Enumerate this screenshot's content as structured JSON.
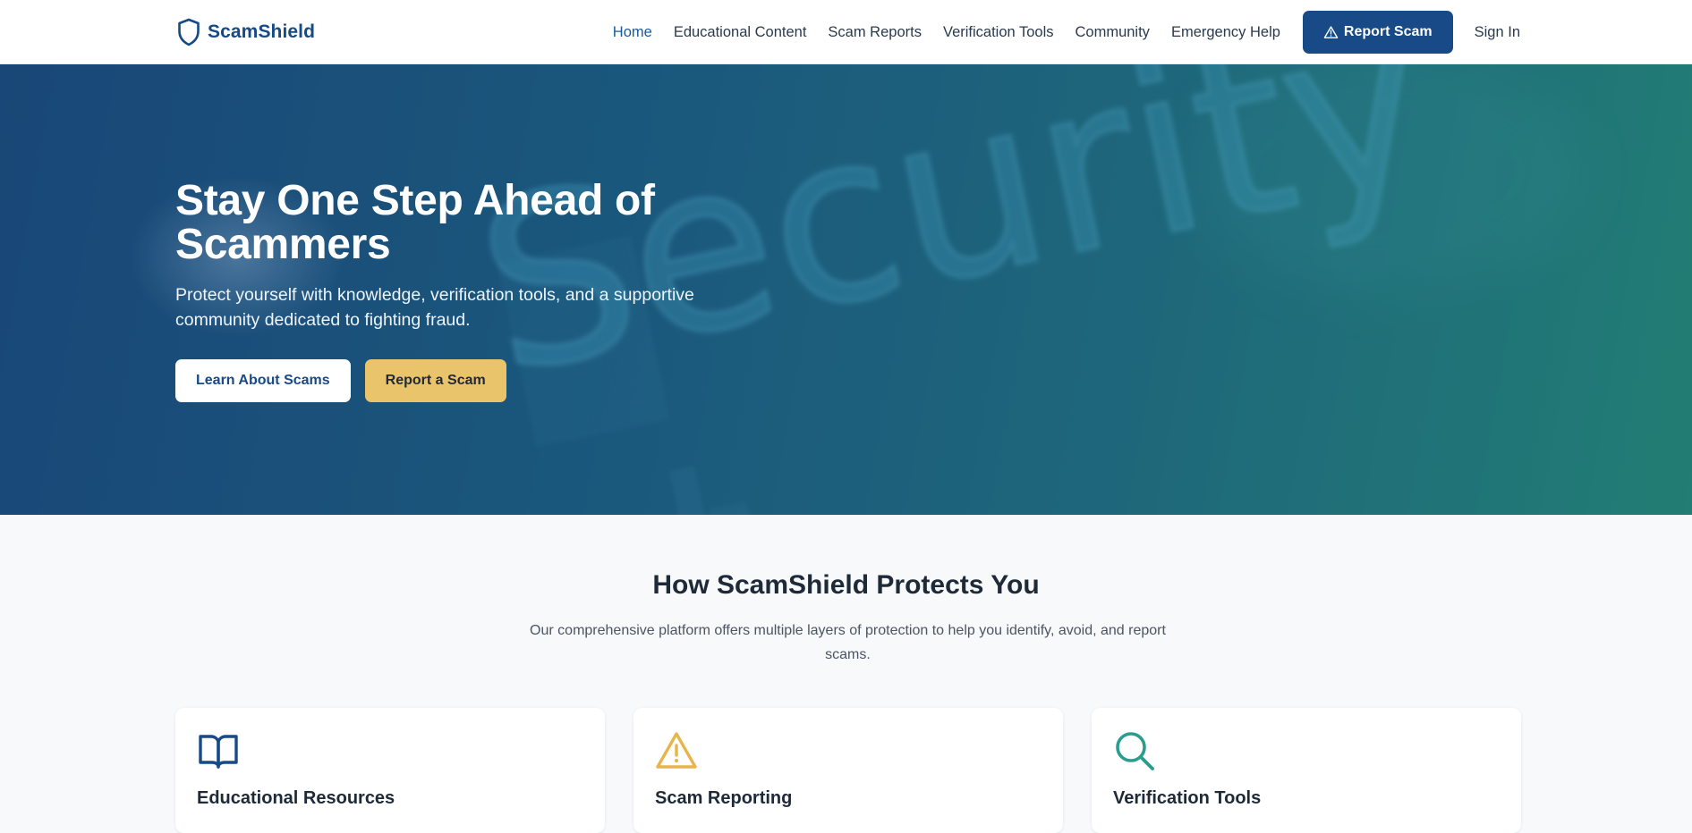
{
  "brand": {
    "name": "ScamShield",
    "color": "#154a86"
  },
  "nav": {
    "links": [
      {
        "label": "Home",
        "active": true
      },
      {
        "label": "Educational Content"
      },
      {
        "label": "Scam Reports"
      },
      {
        "label": "Verification Tools"
      },
      {
        "label": "Community"
      },
      {
        "label": "Emergency Help"
      }
    ],
    "report_button": "Report Scam",
    "sign_in": "Sign In"
  },
  "hero": {
    "title": "Stay One Step Ahead of Scammers",
    "subtitle": "Protect yourself with knowledge, verification tools, and a supportive community dedicated to fighting fraud.",
    "background_word": "Security",
    "buttons": {
      "learn": "Learn About Scams",
      "report": "Report a Scam"
    }
  },
  "features": {
    "title": "How ScamShield Protects You",
    "description": "Our comprehensive platform offers multiple layers of protection to help you identify, avoid, and report scams.",
    "cards": [
      {
        "title": "Educational Resources",
        "icon": "book-open-icon",
        "color": "#174a86"
      },
      {
        "title": "Scam Reporting",
        "icon": "warning-triangle-icon",
        "color": "#e9b44c"
      },
      {
        "title": "Verification Tools",
        "icon": "search-icon",
        "color": "#2a9d8f"
      }
    ]
  },
  "colors": {
    "primary": "#174a86",
    "accent_gold": "#e9c46a",
    "accent_teal": "#2a9d8f",
    "page_bg": "#f7f9fb"
  }
}
